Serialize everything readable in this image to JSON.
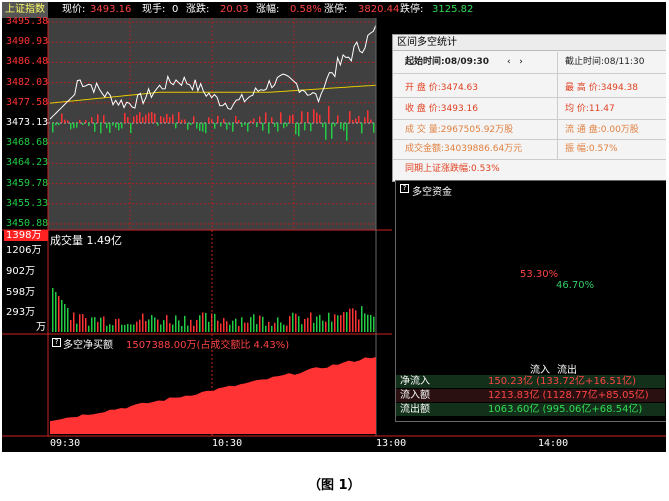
{
  "top": {
    "title": "上证指数",
    "price_label": "现价:",
    "price_value": "3493.16",
    "hand_label": "现手:",
    "hand_value": "0",
    "change_label": "涨跌:",
    "change_value": "20.03",
    "pct_label": "涨幅:",
    "pct_value": "0.58%",
    "limit_up_label": "涨停:",
    "limit_up_value": "3820.44",
    "limit_down_label": "跌停:",
    "limit_down_value": "3125.82"
  },
  "price_axis": [
    "3495.38",
    "3490.93",
    "3486.48",
    "3482.03",
    "3477.58",
    "3473.13",
    "3468.68",
    "3464.23",
    "3459.78",
    "3455.33",
    "3450.88"
  ],
  "volume": {
    "header": "成交量 1.49亿",
    "marker": "1398万",
    "ticks": [
      "1206万",
      "902万",
      "598万",
      "293万",
      "万"
    ]
  },
  "net_buy": {
    "header": "多空净买额",
    "value_text": "1507388.00万(占成交额比 4.43%)"
  },
  "time_axis": [
    "09:30",
    "10:30",
    "13:00",
    "14:00"
  ],
  "interval_panel": {
    "title": "区间多空统计",
    "start_label": "起始时间:",
    "start_value": "08/09:30",
    "end_label": "截止时间:",
    "end_value": "08/11:30",
    "prev_arrow": "‹",
    "next_arrow": "›",
    "rows": [
      {
        "k": "开 盘 价:",
        "v": "3474.63",
        "k2": "最 高 价:",
        "v2": "3494.38"
      },
      {
        "k": "收 盘 价:",
        "v": "3493.16",
        "k2": "均    价:",
        "v2": "11.47"
      },
      {
        "k": "成 交 量:",
        "v": "2967505.92万股",
        "k2": "流 通 盘:",
        "v2": "0.00万股"
      },
      {
        "k": "成交金额:",
        "v": "34039886.64万元",
        "k2": "振    幅:",
        "v2": "0.57%"
      }
    ],
    "sync_label": "同期上证涨跌幅:",
    "sync_value": "0.53%"
  },
  "fund_panel": {
    "title": "多空资金",
    "inflow_pct": "53.30%",
    "outflow_pct": "46.70%",
    "inflow_label": "流入",
    "outflow_label": "流出",
    "rows": [
      {
        "k": "净流入",
        "v": "150.23亿 (133.72亿+16.51亿)"
      },
      {
        "k": "流入额",
        "v": "1213.83亿 (1128.77亿+85.05亿)"
      },
      {
        "k": "流出额",
        "v": "1063.60亿 (995.06亿+68.54亿)"
      }
    ]
  },
  "caption": "（图 1）",
  "colors": {
    "up": "#ff3333",
    "down": "#22cc44",
    "price_line": "#ffffff",
    "avg_line": "#e6c800",
    "net_area": "#ff3333"
  }
}
